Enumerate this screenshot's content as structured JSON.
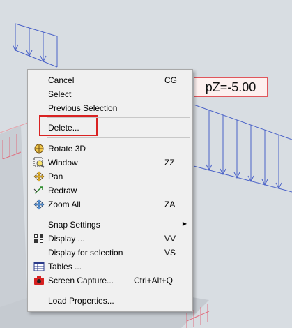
{
  "load_label": "pZ=-5.00",
  "menu": {
    "items": [
      {
        "label": "Cancel",
        "shortcut": "CG"
      },
      {
        "label": "Select",
        "shortcut": ""
      },
      {
        "label": "Previous Selection",
        "shortcut": ""
      },
      {
        "label": "Delete...",
        "shortcut": ""
      },
      {
        "label": "Rotate 3D",
        "shortcut": "",
        "icon": "rotate-3d-icon"
      },
      {
        "label": "Window",
        "shortcut": "ZZ",
        "icon": "zoom-window-icon"
      },
      {
        "label": "Pan",
        "shortcut": "",
        "icon": "pan-icon"
      },
      {
        "label": "Redraw",
        "shortcut": "",
        "icon": "redraw-icon"
      },
      {
        "label": "Zoom All",
        "shortcut": "ZA",
        "icon": "zoom-all-icon"
      },
      {
        "label": "Snap Settings",
        "shortcut": "",
        "submenu": true
      },
      {
        "label": "Display ...",
        "shortcut": "VV",
        "icon": "display-icon"
      },
      {
        "label": "Display for selection",
        "shortcut": "VS"
      },
      {
        "label": "Tables ...",
        "shortcut": "",
        "icon": "tables-icon"
      },
      {
        "label": "Screen Capture...",
        "shortcut": "Ctrl+Alt+Q",
        "icon": "camera-icon"
      },
      {
        "label": "Load Properties...",
        "shortcut": ""
      }
    ],
    "highlighted": "Delete..."
  }
}
